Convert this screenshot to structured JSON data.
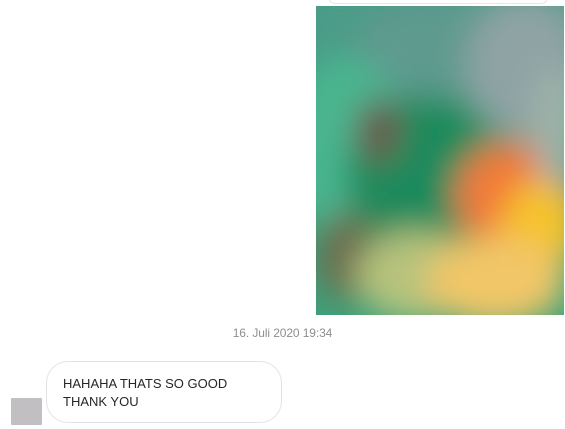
{
  "conversation": {
    "timestamp": "16. Juli 2020 19:34",
    "incoming_message": {
      "lines": [
        "HAHAHA THATS SO GOOD",
        "THANK YOU"
      ]
    },
    "sent_media": {
      "kind": "image",
      "blurred": true
    }
  },
  "colors": {
    "bubble_border": "#e3e3e3",
    "timestamp_text": "#8e8e8e",
    "message_text": "#262626",
    "avatar_placeholder": "#c2bfc3"
  }
}
